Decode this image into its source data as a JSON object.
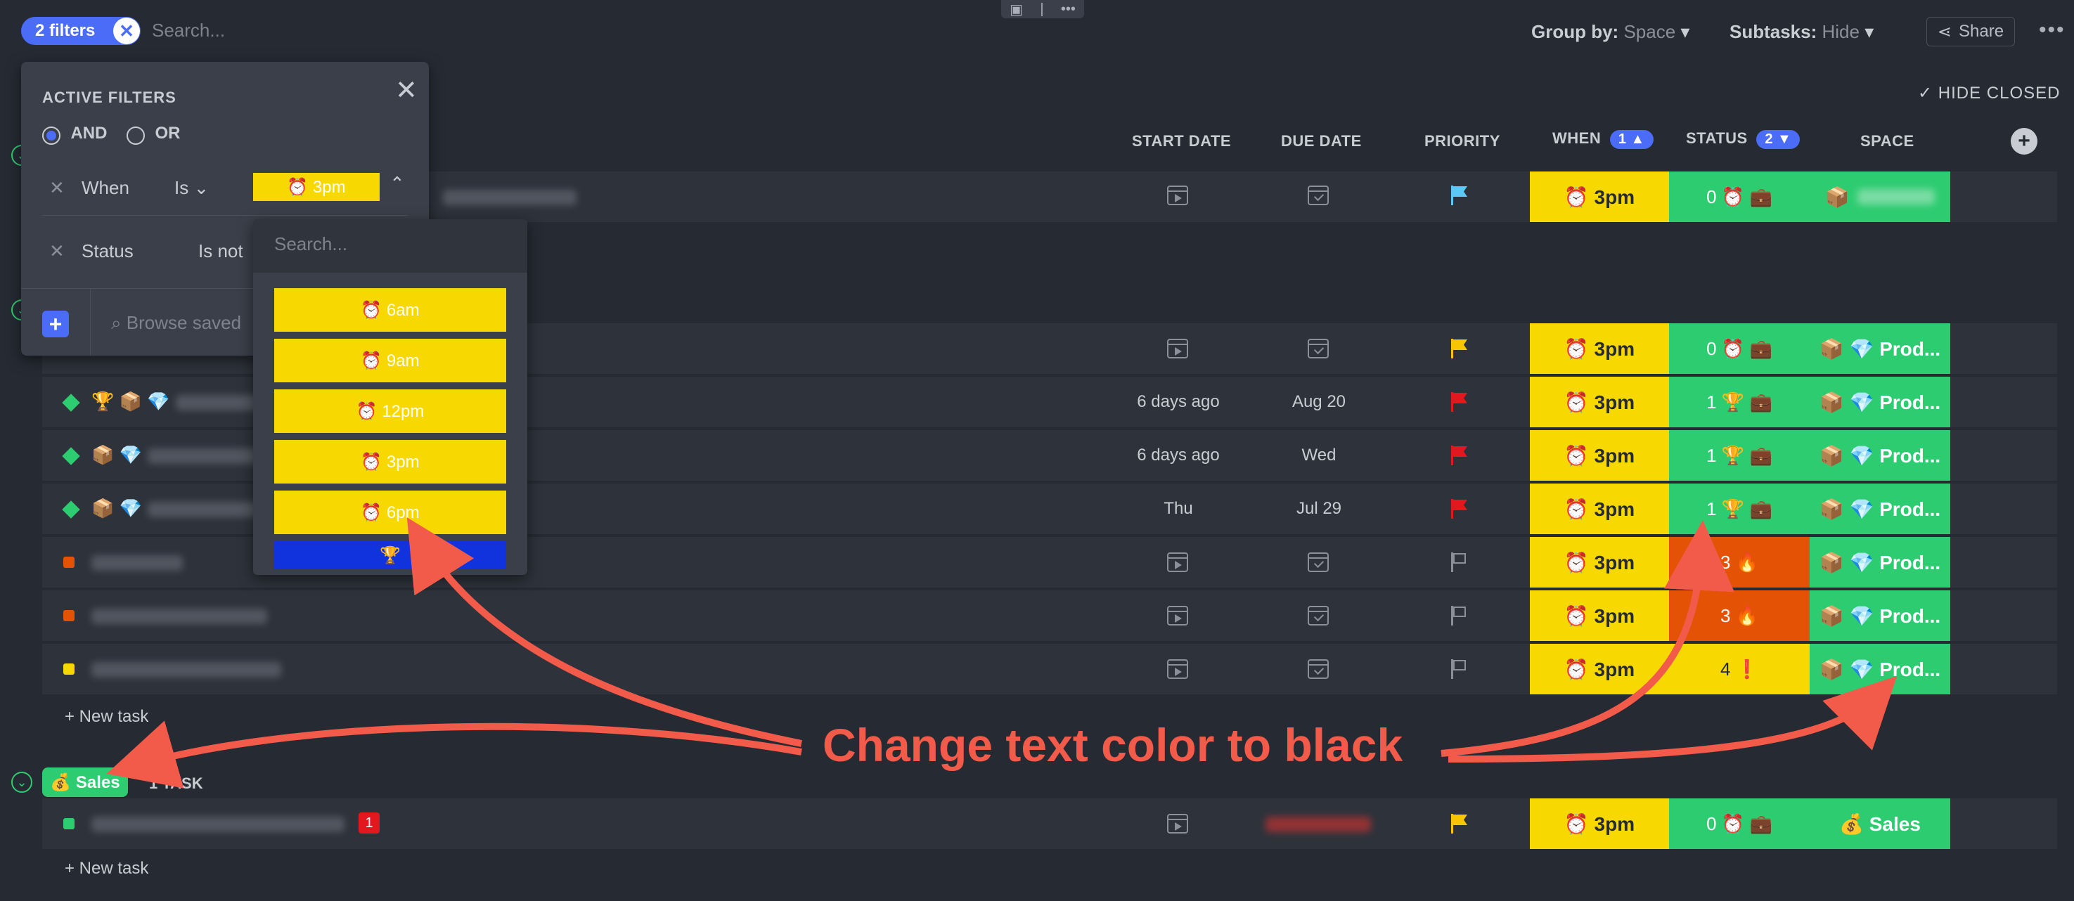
{
  "topbar": {
    "filters_label": "2 filters",
    "search_placeholder": "Search...",
    "group_by_label": "Group by:",
    "group_by_value": "Space",
    "subtasks_label": "Subtasks:",
    "subtasks_value": "Hide",
    "share_label": "Share",
    "hide_closed": "HIDE CLOSED"
  },
  "columns": {
    "start_date": "START DATE",
    "due_date": "DUE DATE",
    "priority": "PRIORITY",
    "when": "WHEN",
    "when_badge": "1",
    "status": "STATUS",
    "status_badge": "2",
    "space": "SPACE"
  },
  "filter_panel": {
    "title": "ACTIVE FILTERS",
    "and_label": "AND",
    "or_label": "OR",
    "filter1_field": "When",
    "filter1_op": "Is",
    "filter1_value": "⏰ 3pm",
    "filter2_field": "Status",
    "filter2_op": "Is not",
    "browse_placeholder": "Browse saved"
  },
  "dropdown": {
    "search_placeholder": "Search...",
    "options": [
      "⏰ 6am",
      "⏰ 9am",
      "⏰ 12pm",
      "⏰ 3pm",
      "⏰ 6pm",
      "🏆"
    ]
  },
  "colors": {
    "accent": "#4a6cf7",
    "when_yellow": "#f7d800",
    "status_green": "#2ecc71",
    "status_orange": "#e35205",
    "space_green": "#2ecc71",
    "annotation": "#f25b4a",
    "background": "#262a33"
  },
  "rows": [
    {
      "icons": "",
      "start": "",
      "due": "",
      "priority": "light-blue",
      "when": "⏰ 3pm",
      "status": "0 ⏰ 💼",
      "space": "📦"
    },
    {
      "icons": "",
      "start": "",
      "due": "",
      "priority": "yellow",
      "when": "⏰ 3pm",
      "status": "0 ⏰ 💼",
      "space": "📦 💎 Prod..."
    },
    {
      "icons": "🏆 📦 💎",
      "start": "6 days ago",
      "due": "Aug 20",
      "priority": "red",
      "when": "⏰ 3pm",
      "status": "1 🏆 💼",
      "space": "📦 💎 Prod..."
    },
    {
      "icons": "📦 💎",
      "start": "6 days ago",
      "due": "Wed",
      "priority": "red",
      "when": "⏰ 3pm",
      "status": "1 🏆 💼",
      "space": "📦 💎 Prod..."
    },
    {
      "icons": "📦 💎",
      "start": "Thu",
      "due": "Jul 29",
      "priority": "red",
      "when": "⏰ 3pm",
      "status": "1 🏆 💼",
      "space": "📦 💎 Prod..."
    },
    {
      "icons": "",
      "start": "",
      "due": "",
      "priority": "none",
      "when": "⏰ 3pm",
      "status": "3 🔥",
      "space": "📦 💎 Prod..."
    },
    {
      "icons": "",
      "start": "",
      "due": "",
      "priority": "none",
      "when": "⏰ 3pm",
      "status": "3 🔥",
      "space": "📦 💎 Prod..."
    },
    {
      "icons": "",
      "start": "",
      "due": "",
      "priority": "none",
      "when": "⏰ 3pm",
      "status": "4 ❗",
      "space": "📦 💎 Prod..."
    }
  ],
  "new_task_label": "+ New task",
  "sales_group": {
    "label": "💰 Sales",
    "count": "1 TASK",
    "row": {
      "badge": "1",
      "priority": "yellow",
      "when": "⏰ 3pm",
      "status": "0 ⏰ 💼",
      "space": "💰 Sales"
    }
  },
  "annotation": "Change text color to black"
}
